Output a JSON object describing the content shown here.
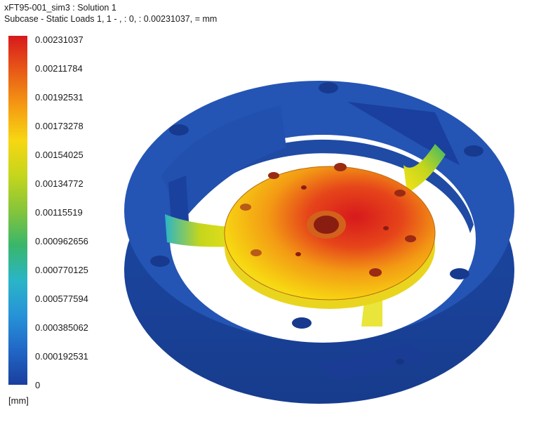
{
  "header": {
    "title": "xFT95-001_sim3 : Solution 1",
    "subcase": "Subcase - Static Loads 1,  1 - ,  : 0,  : 0.00231037,  = mm"
  },
  "legend": {
    "labels": [
      "0.00231037",
      "0.00211784",
      "0.00192531",
      "0.00173278",
      "0.00154025",
      "0.00134772",
      "0.00115519",
      "0.000962656",
      "0.000770125",
      "0.000577594",
      "0.000385062",
      "0.000192531",
      "0"
    ],
    "unit": "[mm]",
    "colors": {
      "max": "#d7191c",
      "high": "#f59a12",
      "mid_high": "#f7d712",
      "mid": "#86c53a",
      "mid_low": "#2ab5c7",
      "low": "#2167c6",
      "min": "#1a3f9e"
    }
  }
}
